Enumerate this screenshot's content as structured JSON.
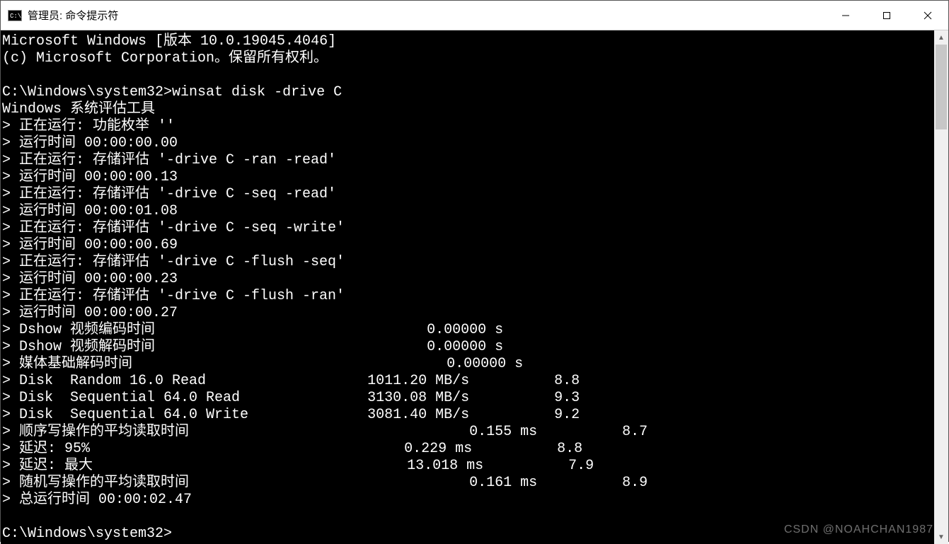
{
  "titlebar": {
    "icon_text": "C:\\",
    "title": "管理员: 命令提示符"
  },
  "terminal": {
    "lines": [
      "Microsoft Windows [版本 10.0.19045.4046]",
      "(c) Microsoft Corporation。保留所有权利。",
      "",
      "C:\\Windows\\system32>winsat disk -drive C",
      "Windows 系统评估工具",
      "> 正在运行: 功能枚举 ''",
      "> 运行时间 00:00:00.00",
      "> 正在运行: 存储评估 '-drive C -ran -read'",
      "> 运行时间 00:00:00.13",
      "> 正在运行: 存储评估 '-drive C -seq -read'",
      "> 运行时间 00:00:01.08",
      "> 正在运行: 存储评估 '-drive C -seq -write'",
      "> 运行时间 00:00:00.69",
      "> 正在运行: 存储评估 '-drive C -flush -seq'",
      "> 运行时间 00:00:00.23",
      "> 正在运行: 存储评估 '-drive C -flush -ran'",
      "> 运行时间 00:00:00.27",
      "> Dshow 视频编码时间                                0.00000 s",
      "> Dshow 视频解码时间                                0.00000 s",
      "> 媒体基础解码时间                                     0.00000 s",
      "> Disk  Random 16.0 Read                   1011.20 MB/s          8.8",
      "> Disk  Sequential 64.0 Read               3130.08 MB/s          9.3",
      "> Disk  Sequential 64.0 Write              3081.40 MB/s          9.2",
      "> 顺序写操作的平均读取时间                                 0.155 ms          8.7",
      "> 延迟: 95%                                     0.229 ms          8.8",
      "> 延迟: 最大                                     13.018 ms          7.9",
      "> 随机写操作的平均读取时间                                 0.161 ms          8.9",
      "> 总运行时间 00:00:02.47",
      "",
      "C:\\Windows\\system32>"
    ]
  },
  "watermark": "CSDN @NOAHCHAN1987"
}
